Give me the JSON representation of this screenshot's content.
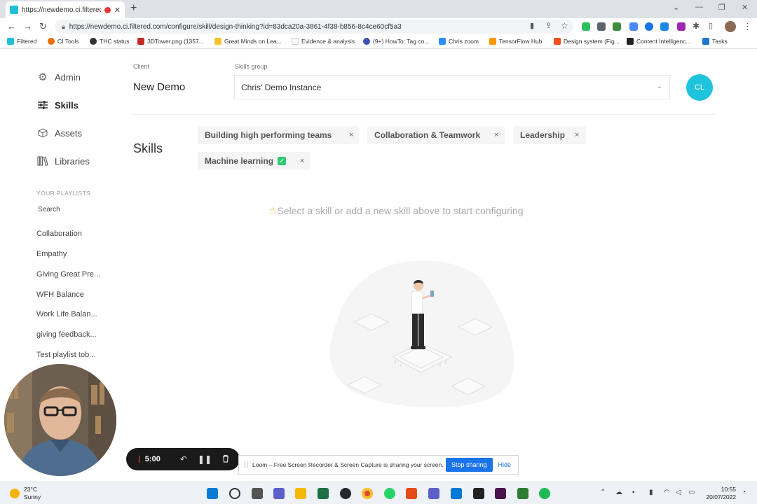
{
  "browser": {
    "tab_title": "https://newdemo.ci.filtered.co",
    "url": "https://newdemo.ci.filtered.com/configure/skill/design-thinking?id=83dca20a-3861-4f38-b856-8c4ce60cf5a3",
    "bookmarks": [
      "Filtered",
      "CI Tools",
      "THC status",
      "3DTower.png (1357...",
      "Great Minds on Lea...",
      "Evidence & analysis",
      "(9+) HowTo: Tag co...",
      "Chris zoom",
      "TensorFlow Hub",
      "Design system (Fig...",
      "Content Intelligenc...",
      "Tasks"
    ]
  },
  "sidebar": {
    "items": [
      {
        "label": "Admin",
        "icon": "gear-icon"
      },
      {
        "label": "Skills",
        "icon": "sliders-icon"
      },
      {
        "label": "Assets",
        "icon": "cube-icon"
      },
      {
        "label": "Libraries",
        "icon": "books-icon"
      }
    ],
    "playlists_heading": "YOUR PLAYLISTS",
    "search_label": "Search",
    "playlists": [
      "Collaboration",
      "Empathy",
      "Giving Great Pre...",
      "WFH Balance",
      "Work Life Balan...",
      "giving feedback...",
      "Test playlist tob..."
    ]
  },
  "header": {
    "client_label": "Client",
    "client_name": "New Demo",
    "skills_group_label": "Skills group",
    "skills_group_value": "Chris' Demo Instance",
    "user_initials": "CL"
  },
  "skills": {
    "title": "Skills",
    "chips": [
      "Building high performing teams",
      "Collaboration & Teamwork",
      "Leadership",
      "Machine learning"
    ],
    "remove_glyph": "×",
    "check_glyph": "✓",
    "hint": "Select a skill or add a new skill above to start configuring"
  },
  "loom": {
    "timer": "5:00",
    "share_text": "Loom – Free Screen Recorder & Screen Capture is sharing your screen.",
    "stop_sharing": "Stop sharing",
    "hide": "Hide"
  },
  "taskbar": {
    "temp": "23°C",
    "condition": "Sunny",
    "time": "10:55",
    "date": "20/07/2022"
  },
  "colors": {
    "accent": "#1ec4de",
    "check": "#2ecc71",
    "loom_stop": "#ff5a36",
    "stop_sharing": "#1a73e8"
  }
}
